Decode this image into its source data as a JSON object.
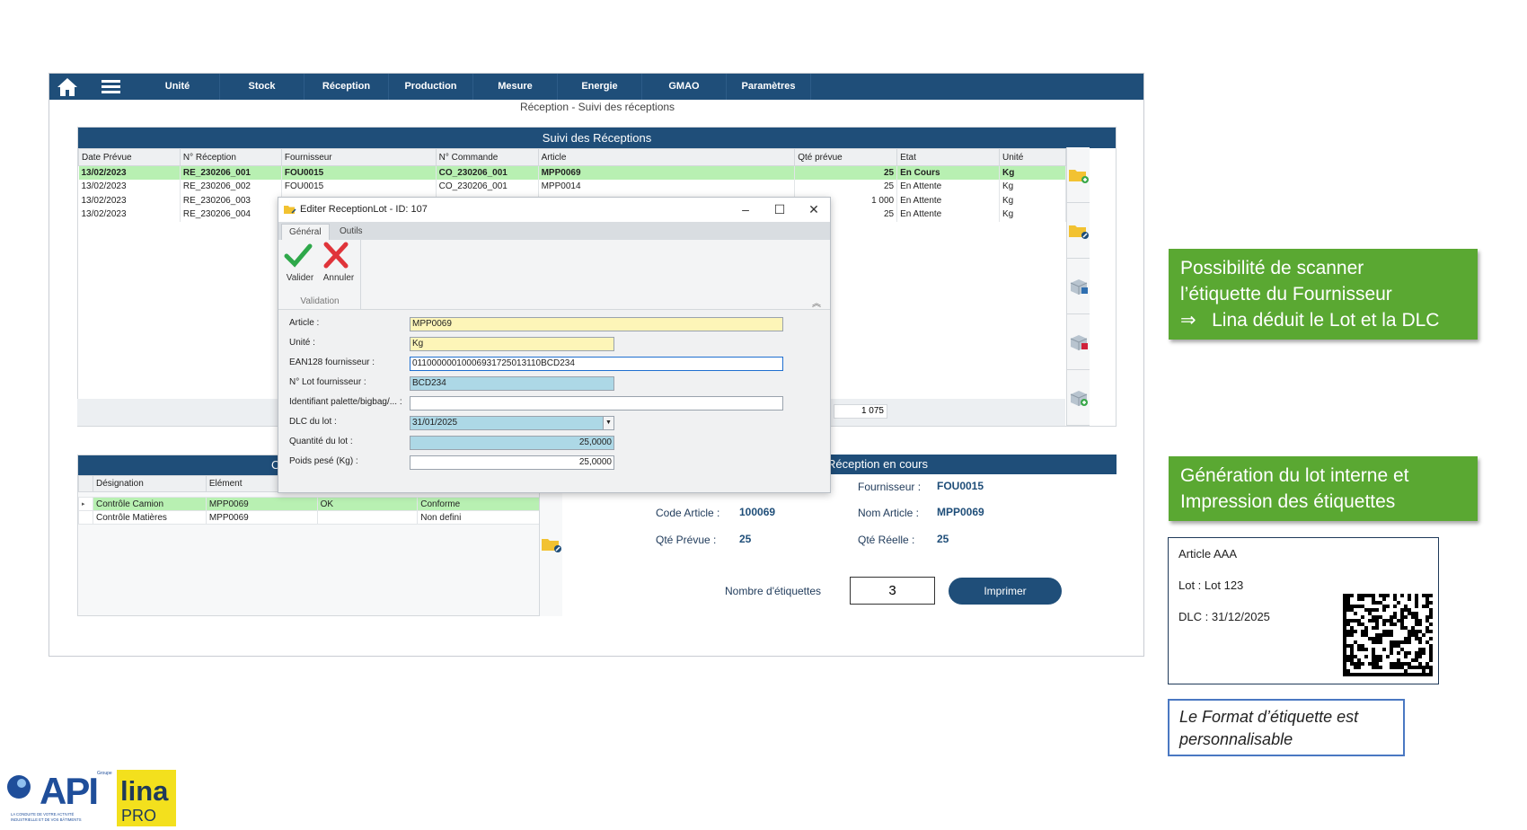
{
  "nav": {
    "items": [
      "Unité",
      "Stock",
      "Réception",
      "Production",
      "Mesure",
      "Energie",
      "GMAO",
      "Paramètres"
    ]
  },
  "page_subtitle": "Réception - Suivi des réceptions",
  "receptions_grid": {
    "title": "Suivi des Réceptions",
    "columns": [
      "Date Prévue",
      "N° Réception",
      "Fournisseur",
      "N° Commande",
      "Article",
      "Qté prévue",
      "Etat",
      "Unité"
    ],
    "rows": [
      [
        "13/02/2023",
        "RE_230206_001",
        "FOU0015",
        "CO_230206_001",
        "MPP0069",
        "25",
        "En Cours",
        "Kg"
      ],
      [
        "13/02/2023",
        "RE_230206_002",
        "FOU0015",
        "CO_230206_001",
        "MPP0014",
        "25",
        "En Attente",
        "Kg"
      ],
      [
        "13/02/2023",
        "RE_230206_003",
        "",
        "",
        "",
        "1 000",
        "En Attente",
        "Kg"
      ],
      [
        "13/02/2023",
        "RE_230206_004",
        "",
        "",
        "",
        "25",
        "En Attente",
        "Kg"
      ]
    ],
    "total": "1 075"
  },
  "controls_grid": {
    "header_letter": "C",
    "columns": [
      "Désignation",
      "Elément",
      "",
      ""
    ],
    "rows": [
      [
        "Contrôle Camion",
        "MPP0069",
        "OK",
        "Conforme"
      ],
      [
        "Contrôle Matières",
        "MPP0069",
        "",
        "Non defini"
      ]
    ]
  },
  "reception_panel": {
    "title": "Réception en cours",
    "fournisseur_label": "Fournisseur :",
    "fournisseur_value": "FOU0015",
    "code_article_label": "Code Article :",
    "code_article_value": "100069",
    "nom_article_label": "Nom Article :",
    "nom_article_value": "MPP0069",
    "qte_prevue_label": "Qté Prévue :",
    "qte_prevue_value": "25",
    "qte_reelle_label": "Qté Réelle :",
    "qte_reelle_value": "25",
    "nb_etiquettes_label": "Nombre d'étiquettes",
    "nb_etiquettes_value": "3",
    "print_label": "Imprimer"
  },
  "dialog": {
    "title": "Editer ReceptionLot - ID: 107",
    "tabs": [
      "Général",
      "Outils"
    ],
    "valider": "Valider",
    "annuler": "Annuler",
    "group_label": "Validation",
    "fields": {
      "article_label": "Article :",
      "article_value": "MPP0069",
      "unite_label": "Unité :",
      "unite_value": "Kg",
      "ean_label": "EAN128 fournisseur :",
      "ean_value": "01100000010006931725013110BCD234",
      "lot_label": "N° Lot fournisseur :",
      "lot_value": "BCD234",
      "palette_label": "Identifiant palette/bigbag/... :",
      "palette_value": "",
      "dlc_label": "DLC du lot :",
      "dlc_value": "31/01/2025",
      "qte_label": "Quantité du lot :",
      "qte_value": "25,0000",
      "poids_label": "Poids pesé (Kg) :",
      "poids_value": "25,0000"
    }
  },
  "callout_scan": {
    "line1": "Possibilité de scanner",
    "line2": "l’étiquette du Fournisseur",
    "arrow": "⇒",
    "line3": "Lina déduit le Lot et la DLC"
  },
  "callout_lot": {
    "line1": "Génération du lot interne et",
    "line2": "Impression des étiquettes"
  },
  "label_sample": {
    "article": "Article AAA",
    "lot": "Lot : Lot 123",
    "dlc": "DLC : 31/12/2025"
  },
  "note": "Le Format d’étiquette est personnalisable",
  "logo": {
    "api": "API",
    "groupe": "Groupe",
    "tagline": "LA CONDUITE DE VOTRE ACTIVITÉ INDUSTRIELLE ET DE VOS BÂTIMENTS",
    "lina": "lina",
    "pro": "PRO"
  },
  "colors": {
    "nav_blue": "#1f4e79",
    "selected_row": "#b8f0b2",
    "callout_green": "#5aa832",
    "field_yellow": "#fdf5b8",
    "field_blue": "#add8e6"
  }
}
